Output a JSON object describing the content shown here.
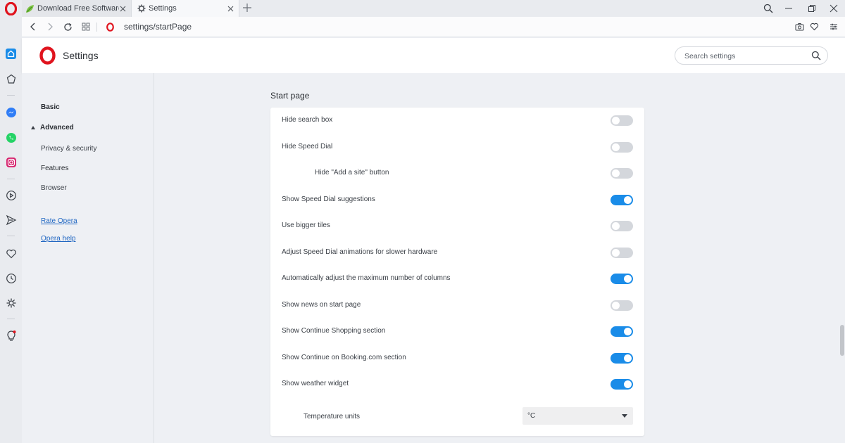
{
  "tabs": [
    {
      "title": "Download Free Software fo",
      "favicon": "softpedia-leaf-icon"
    },
    {
      "title": "Settings",
      "favicon": "gear-icon"
    }
  ],
  "address": {
    "url": "settings/startPage"
  },
  "header": {
    "title": "Settings",
    "search_placeholder": "Search settings"
  },
  "leftnav": {
    "basic": "Basic",
    "advanced": "Advanced",
    "privacy": "Privacy & security",
    "features": "Features",
    "browser": "Browser",
    "rate": "Rate Opera",
    "help": "Opera help"
  },
  "section": {
    "title": "Start page"
  },
  "settings": [
    {
      "label": "Hide search box",
      "on": false
    },
    {
      "label": "Hide Speed Dial",
      "on": false
    },
    {
      "label": "Hide \"Add a site\" button",
      "on": false
    },
    {
      "label": "Show Speed Dial suggestions",
      "on": true
    },
    {
      "label": "Use bigger tiles",
      "on": false
    },
    {
      "label": "Adjust Speed Dial animations for slower hardware",
      "on": false
    },
    {
      "label": "Automatically adjust the maximum number of columns",
      "on": true
    },
    {
      "label": "Show news on start page",
      "on": false
    },
    {
      "label": "Show Continue Shopping section",
      "on": true
    },
    {
      "label": "Show Continue on Booking.com section",
      "on": true
    },
    {
      "label": "Show weather widget",
      "on": true
    }
  ],
  "temperature": {
    "label": "Temperature units",
    "value": "°C"
  },
  "colors": {
    "accent": "#1a8ce8",
    "opera_red": "#e0141e",
    "link": "#1f66c2"
  }
}
